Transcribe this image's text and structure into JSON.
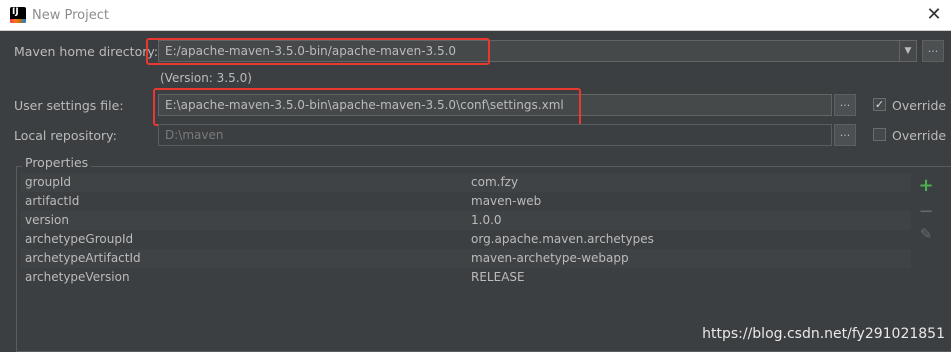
{
  "window": {
    "title": "New Project",
    "app_icon": "intellij-icon",
    "close_symbol": "✕"
  },
  "maven_home": {
    "label": "Maven home directory:",
    "value": "E:/apache-maven-3.5.0-bin/apache-maven-3.5.0",
    "version_text": "(Version: 3.5.0)",
    "dropdown_symbol": "▼",
    "browse_symbol": "..."
  },
  "user_settings": {
    "label": "User settings file:",
    "value": "E:\\apache-maven-3.5.0-bin\\apache-maven-3.5.0\\conf\\settings.xml",
    "browse_symbol": "...",
    "override_label": "Override",
    "override_checked": true
  },
  "local_repo": {
    "label": "Local repository:",
    "value": "D:\\maven",
    "browse_symbol": "...",
    "override_label": "Override",
    "override_checked": false
  },
  "properties": {
    "title": "Properties",
    "rows": [
      {
        "key": "groupId",
        "value": "com.fzy"
      },
      {
        "key": "artifactId",
        "value": "maven-web"
      },
      {
        "key": "version",
        "value": "1.0.0"
      },
      {
        "key": "archetypeGroupId",
        "value": "org.apache.maven.archetypes"
      },
      {
        "key": "archetypeArtifactId",
        "value": "maven-archetype-webapp"
      },
      {
        "key": "archetypeVersion",
        "value": "RELEASE"
      }
    ],
    "tools": {
      "add_symbol": "+",
      "remove_symbol": "−",
      "edit_symbol": "✎"
    }
  },
  "watermark": "https://blog.csdn.net/fy291021851",
  "colors": {
    "background": "#3c3f41",
    "highlight_box": "#e8382f",
    "add_icon": "#4caf50",
    "text": "#bbbbbb"
  }
}
